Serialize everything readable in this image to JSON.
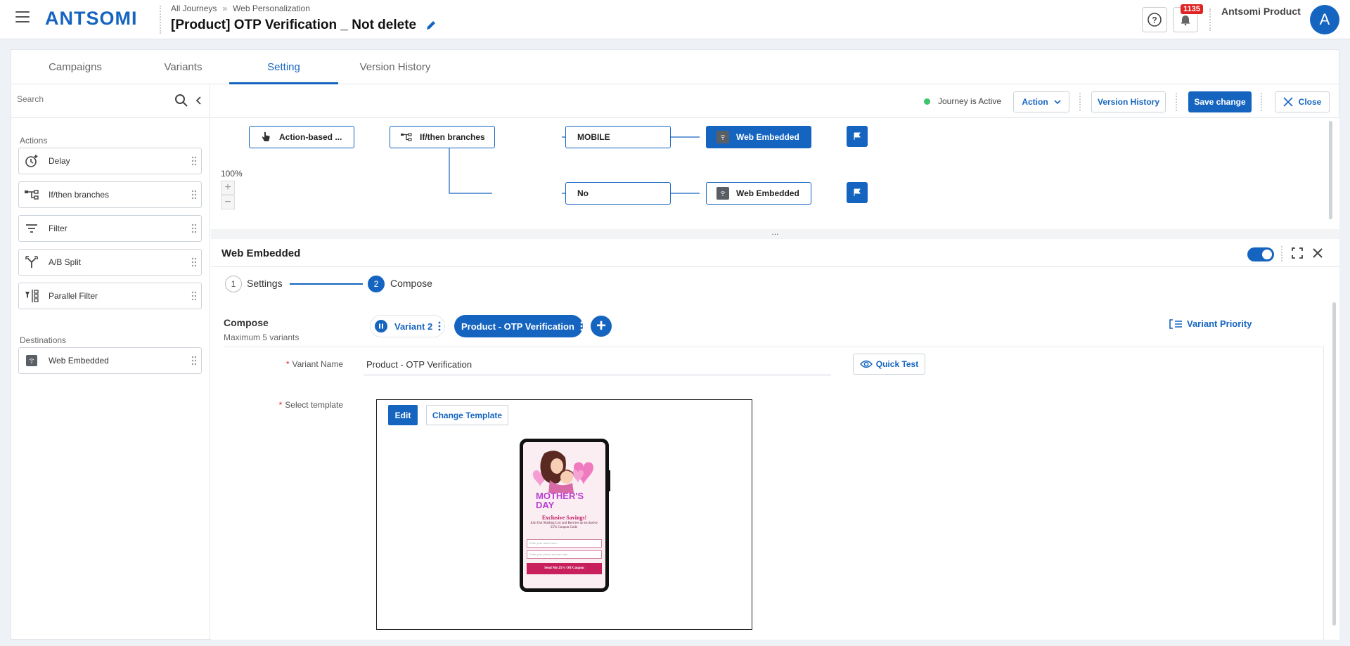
{
  "header": {
    "logo": "ANTSOMI",
    "breadcrumb": [
      "All Journeys",
      "Web Personalization"
    ],
    "breadcrumb_sep": "»",
    "title": "[Product] OTP Verification _ Not delete",
    "notification_count": "1135",
    "account_name": "Antsomi Product",
    "avatar_initial": "A"
  },
  "tabs": [
    "Campaigns",
    "Variants",
    "Setting",
    "Version History"
  ],
  "active_tab": "Setting",
  "sidebar": {
    "search_placeholder": "Search",
    "actions_heading": "Actions",
    "actions": [
      {
        "label": "Delay",
        "icon": "clock-plus-icon"
      },
      {
        "label": "If/then branches",
        "icon": "branch-icon"
      },
      {
        "label": "Filter",
        "icon": "filter-icon"
      },
      {
        "label": "A/B Split",
        "icon": "split-icon"
      },
      {
        "label": "Parallel Filter",
        "icon": "parallel-filter-icon"
      }
    ],
    "destinations_heading": "Destinations",
    "destinations": [
      {
        "label": "Web Embedded",
        "icon": "wifi-box-icon"
      }
    ]
  },
  "toolbar": {
    "status": "Journey is Active",
    "action_label": "Action",
    "version_history_label": "Version History",
    "save_label": "Save change",
    "close_label": "Close"
  },
  "flow": {
    "zoom": "100%",
    "trigger": "Action-based ...",
    "branch": "If/then branches",
    "branch_a": "MOBILE",
    "branch_b": "No",
    "dest_a": "Web Embedded",
    "dest_b": "Web Embedded",
    "handle": "..."
  },
  "detail": {
    "title": "Web Embedded",
    "enabled": true,
    "steps": [
      {
        "num": "1",
        "label": "Settings"
      },
      {
        "num": "2",
        "label": "Compose"
      }
    ],
    "compose_title": "Compose",
    "compose_sub": "Maximum 5 variants",
    "variants": [
      "Variant 2",
      "Product - OTP Verification"
    ],
    "selected_variant": "Product - OTP Verification",
    "variant_priority_label": "Variant Priority",
    "variant_name_label": "Variant Name",
    "variant_name_value": "Product - OTP Verification",
    "quick_test_label": "Quick Test",
    "select_template_label": "Select template",
    "edit_label": "Edit",
    "change_template_label": "Change Template"
  },
  "template_preview": {
    "headline": "MOTHER'S\nDAY",
    "sub": "Exclusive Savings!",
    "copy": "Join Our Mailing List and Receive an exclusive 25% Coupon Code",
    "name_placeholder": "Enter your name here...",
    "phone_placeholder": "Enter your phone number here...",
    "cta": "Send Me 25% Off Coupon"
  },
  "colors": {
    "accent": "#1565c0",
    "active_status": "#3cc46a",
    "badge": "#e02424"
  }
}
